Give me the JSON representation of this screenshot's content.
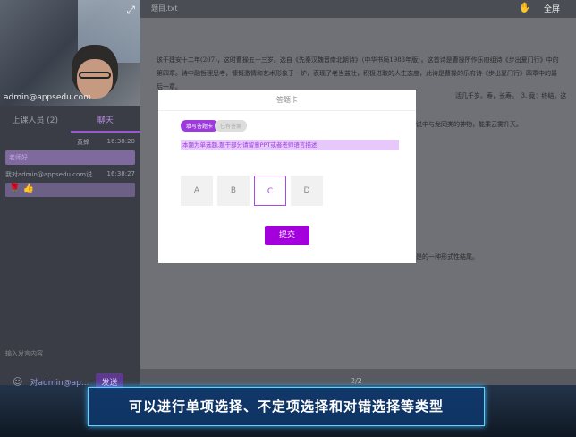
{
  "video": {
    "email": "admin@appsedu.com",
    "expand_icon": "expand-icon"
  },
  "tabs": [
    {
      "label": "上课人员 (2)"
    },
    {
      "label": "聊天"
    }
  ],
  "chat": {
    "messages": [
      {
        "sender": "黄蜂",
        "time": "16:38:20",
        "text": "老师好"
      },
      {
        "sender": "我对admin@appsedu.com说",
        "time": "16:38:27",
        "text": "🌹 👍"
      }
    ],
    "input_placeholder": "输入发言内容",
    "to_label": "对admin@ap...",
    "send_label": "发送"
  },
  "topbar": {
    "title": "题目.txt",
    "fullscreen_label": "全屏"
  },
  "doc": {
    "para1": "该于建安十二年(207)，这时曹操五十三岁。选自《先秦汉魏晋南北朝诗》（中华书局1983年版）。这首诗是曹操所作乐府组诗《步出夏门行》中的第四章。诗中融哲理思考，慷慨激情和艺术形象于一炉，表现了老当益壮，积极进取的人生态度，此诗是曹操的乐府诗《步出夏门行》四章中的最后一章。",
    "frag1": "活几千岁。寿，长寿。　3. 竟：终结，这",
    "frag2": "说中与龙同类的神物，能乘云雾升天。",
    "frag3": "是的一种形式性结尾。",
    "page": "2/2"
  },
  "dialog": {
    "title": "答题卡",
    "pill_active": "填写答题卡",
    "pill_inactive": "已有答案",
    "hint": "本题为单选题,题干部分请留意PPT或者老师语言描述",
    "options": [
      "A",
      "B",
      "C",
      "D"
    ],
    "selected": "C",
    "submit_label": "提交"
  },
  "banner": {
    "text": "可以进行单项选择、不定项选择和对错选择等类型"
  }
}
